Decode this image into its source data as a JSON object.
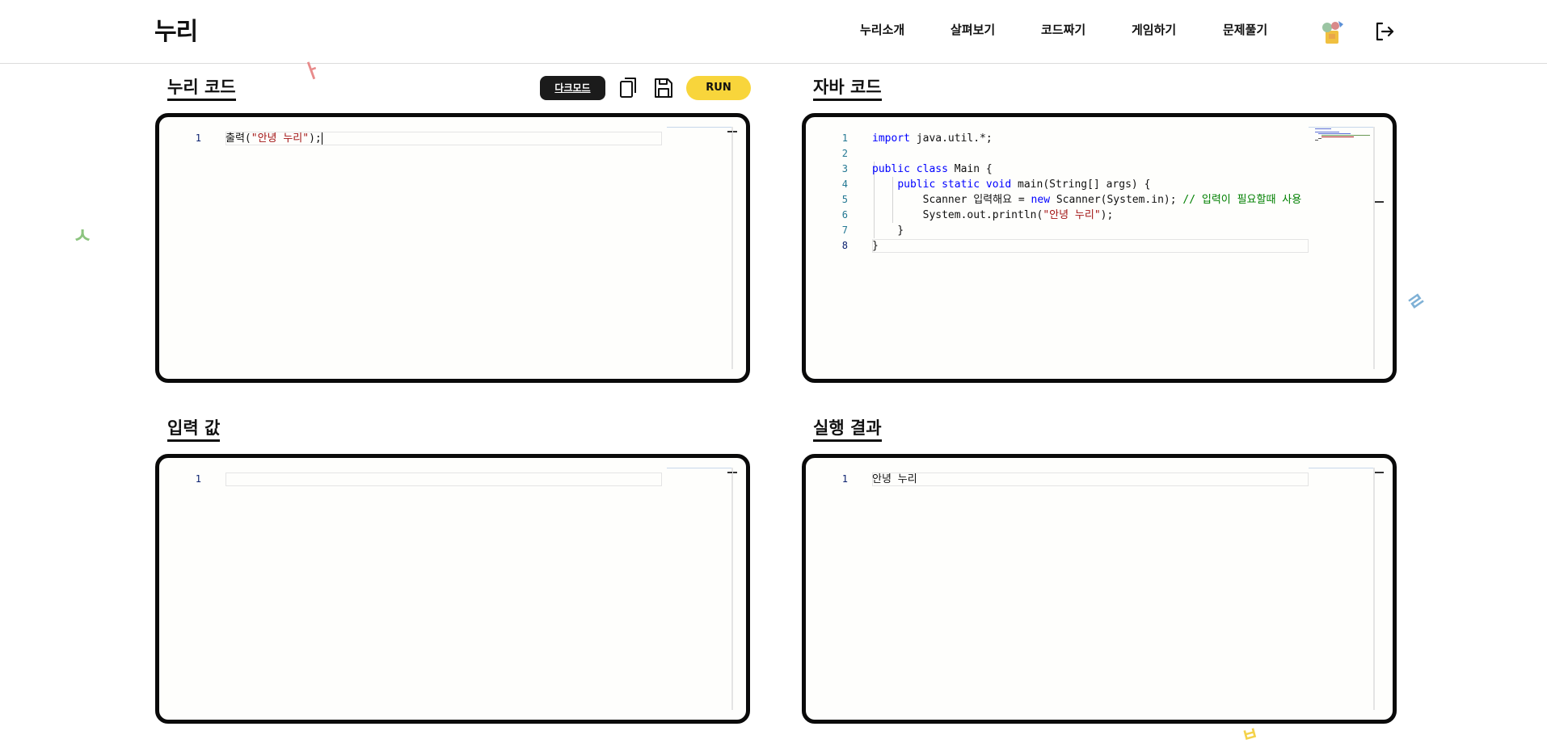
{
  "app": {
    "logo": "누리",
    "nav": [
      "누리소개",
      "살펴보기",
      "코드짜기",
      "게임하기",
      "문제풀기"
    ]
  },
  "decorations": [
    "ㅏ",
    "ㅅ",
    "ㄹ",
    "ㅂ"
  ],
  "toolbar": {
    "dark_mode_label": "다크모드",
    "run_label": "RUN"
  },
  "panels": {
    "nuri_code": {
      "title": "누리 코드",
      "lines": [
        {
          "num": "1",
          "segments": [
            {
              "t": "출력(",
              "c": ""
            },
            {
              "t": "\"안녕 누리\"",
              "c": "str"
            },
            {
              "t": ");",
              "c": ""
            }
          ]
        }
      ]
    },
    "java_code": {
      "title": "자바 코드",
      "lines": [
        {
          "num": "1",
          "segments": [
            {
              "t": "import",
              "c": "kw"
            },
            {
              "t": " java.util.*;",
              "c": ""
            }
          ]
        },
        {
          "num": "2",
          "segments": []
        },
        {
          "num": "3",
          "segments": [
            {
              "t": "public class",
              "c": "kw"
            },
            {
              "t": " Main {",
              "c": ""
            }
          ]
        },
        {
          "num": "4",
          "segments": [
            {
              "t": "    ",
              "c": ""
            },
            {
              "t": "public static void",
              "c": "kw"
            },
            {
              "t": " main(String[] args) {",
              "c": ""
            }
          ]
        },
        {
          "num": "5",
          "segments": [
            {
              "t": "        Scanner 입력해요 = ",
              "c": ""
            },
            {
              "t": "new",
              "c": "kw"
            },
            {
              "t": " Scanner(System.in); ",
              "c": ""
            },
            {
              "t": "// 입력이 필요할때 사용",
              "c": "cmt"
            }
          ]
        },
        {
          "num": "6",
          "segments": [
            {
              "t": "        System.out.println(",
              "c": ""
            },
            {
              "t": "\"안녕 누리\"",
              "c": "str"
            },
            {
              "t": ");",
              "c": ""
            }
          ]
        },
        {
          "num": "7",
          "segments": [
            {
              "t": "    }",
              "c": ""
            }
          ]
        },
        {
          "num": "8",
          "segments": [
            {
              "t": "}",
              "c": ""
            }
          ]
        }
      ]
    },
    "input": {
      "title": "입력 값",
      "lines": [
        {
          "num": "1",
          "segments": []
        }
      ]
    },
    "output": {
      "title": "실행 결과",
      "lines": [
        {
          "num": "1",
          "segments": [
            {
              "t": "안녕 누리",
              "c": ""
            }
          ]
        }
      ]
    }
  },
  "colors": {
    "run_button": "#f8d53b",
    "dark_button": "#1b1b1b",
    "keyword": "#0000ff",
    "string": "#a31515",
    "comment": "#008000"
  }
}
